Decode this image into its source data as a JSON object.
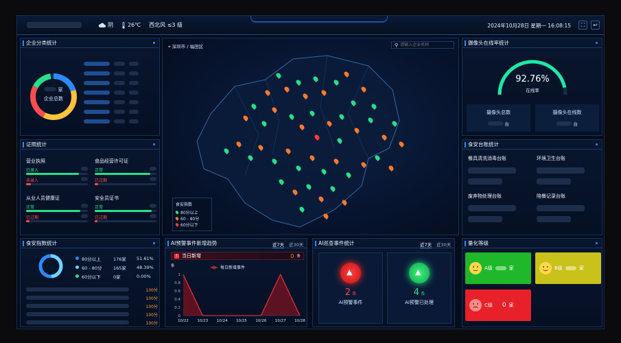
{
  "topbar": {
    "weather": "阴",
    "temperature": "26℃",
    "wind": "西北风 ≤3 级",
    "datetime": "2024年10月28日 星期一 16:08:15",
    "icons": [
      "cloud-icon",
      "thermometer-icon",
      "fullscreen-icon",
      "back-icon"
    ]
  },
  "enterprise": {
    "title": "企业分类统计",
    "center_unit": "家",
    "center_label": "企业总数",
    "ring_colors": [
      "#2b8cff",
      "#27e08a",
      "#ffc23a",
      "#ff4d4f",
      "#8a5cff"
    ]
  },
  "license": {
    "title": "证照统计",
    "items": [
      {
        "label": "营业执照",
        "ok": "已录入",
        "bad": "未录入",
        "ok_frac": 0.85
      },
      {
        "label": "食品经营许可证",
        "ok": "正常",
        "bad": "已过期",
        "ok_frac": 0.9
      },
      {
        "label": "从业人员健康证",
        "ok": "正常",
        "bad": "已过期",
        "ok_frac": 0.88
      },
      {
        "label": "安全员证书",
        "ok": "正常",
        "bad": "已过期",
        "ok_frac": 0.92
      }
    ]
  },
  "safety": {
    "title": "食安指数统计",
    "rows": [
      {
        "label": "80分以上",
        "count": "176家",
        "pct": "51.61%",
        "color": "#2b8cff"
      },
      {
        "label": "60 - 80分",
        "count": "165家",
        "pct": "48.39%",
        "color": "#6fd3ff"
      },
      {
        "label": "60分以下",
        "count": "0家",
        "pct": "0.00%",
        "color": "#27e08a"
      }
    ],
    "scores": [
      "100分",
      "100分",
      "100分",
      "100分",
      "100分"
    ]
  },
  "map": {
    "breadcrumb": "深圳市 / 福田区",
    "search_placeholder": "请输入企业名称",
    "legend_title": "食安指数",
    "legend": [
      {
        "label": "80分以上",
        "color": "#27e08a"
      },
      {
        "label": "60 - 80分",
        "color": "#ff7a2e"
      },
      {
        "label": "60分以下",
        "color": "#ff3b3b"
      }
    ]
  },
  "ai_trend": {
    "title": "AI预警事件新增趋势",
    "tabs": [
      "近7天",
      "近30天"
    ],
    "today_label": "当日新增",
    "today_count": "0",
    "today_unit": "条",
    "unit": "条",
    "legend": "每日新增事件",
    "chart_data": {
      "type": "area",
      "x": [
        "10/22",
        "10/23",
        "10/24",
        "10/25",
        "10/26",
        "10/27",
        "10/28"
      ],
      "values": [
        1,
        0,
        0,
        0,
        0,
        1,
        0
      ],
      "ylim": [
        0,
        1
      ],
      "yticks": [
        "1",
        "0.8",
        "0.6",
        "0.4",
        "0.2",
        "0"
      ]
    }
  },
  "ai_patrol": {
    "title": "AI巡查事件统计",
    "tabs": [
      "近7天",
      "近30天"
    ],
    "warn_count": "2",
    "warn_unit": "条",
    "warn_label": "AI预警事件",
    "done_count": "4",
    "done_unit": "条",
    "done_label": "AI预警已处理"
  },
  "camera": {
    "title": "摄像头在线率统计",
    "rate": "92.76%",
    "rate_value": 92.76,
    "rate_label": "在线率",
    "total_label": "摄像头总数",
    "online_label": "摄像头在线数",
    "unit": "台"
  },
  "ledger": {
    "title": "食安台账统计",
    "items": [
      "餐具清洗消毒台账",
      "环境卫生台账",
      "废弃物处理台账",
      "陪餐记录台账"
    ]
  },
  "grade": {
    "title": "量化等级",
    "items": [
      {
        "label": "A级",
        "unit": "家",
        "color": "#1fb82b"
      },
      {
        "label": "B级",
        "unit": "家",
        "color": "#c8c21a"
      },
      {
        "label": "C级",
        "count": "0",
        "unit": "家",
        "color": "#e8202a"
      }
    ]
  }
}
